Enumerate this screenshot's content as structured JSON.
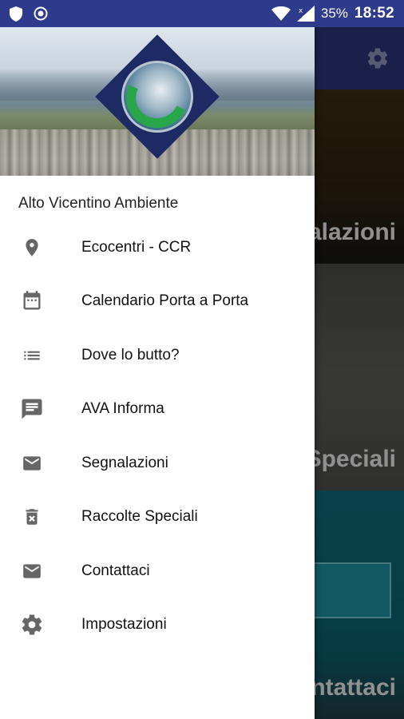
{
  "status_bar": {
    "battery": "35%",
    "time": "18:52",
    "icons": [
      "shield-icon",
      "record-icon",
      "wifi-icon",
      "signal-icon"
    ]
  },
  "drawer": {
    "header_subtitle": "Alto Vicentino Ambiente",
    "items": [
      {
        "label": "Ecocentri - CCR",
        "icon": "location-pin-icon"
      },
      {
        "label": "Calendario Porta a Porta",
        "icon": "calendar-icon"
      },
      {
        "label": "Dove lo butto?",
        "icon": "list-icon"
      },
      {
        "label": "AVA Informa",
        "icon": "message-icon"
      },
      {
        "label": "Segnalazioni",
        "icon": "mail-icon"
      },
      {
        "label": "Raccolte Speciali",
        "icon": "trash-icon"
      },
      {
        "label": "Contattaci",
        "icon": "mail-icon"
      },
      {
        "label": "Impostazioni",
        "icon": "gear-icon"
      }
    ]
  },
  "background": {
    "tiles": [
      {
        "label": "alazioni"
      },
      {
        "label": "Speciali"
      },
      {
        "label": "ntattaci"
      }
    ]
  },
  "colors": {
    "status_bar": "#2e3a8c",
    "app_bar": "#2a3578",
    "icon_gray": "#666666",
    "logo_navy": "#1e2a63",
    "logo_green": "#27a64a"
  }
}
